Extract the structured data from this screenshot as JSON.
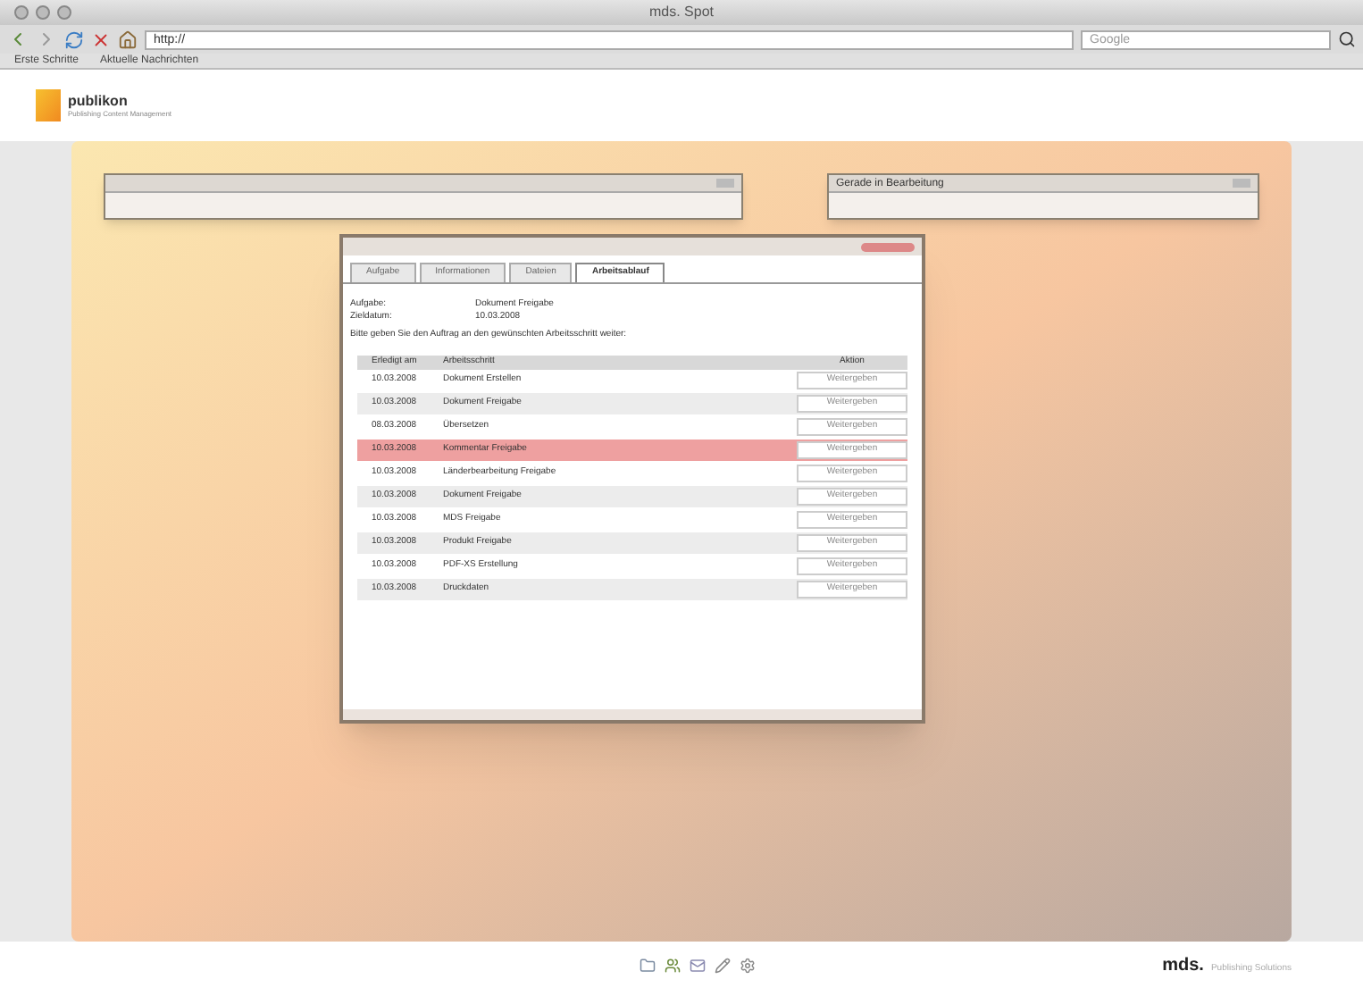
{
  "browser": {
    "title": "mds. Spot",
    "address": "http://",
    "search_placeholder": "Google",
    "bookmarks": [
      "Erste Schritte",
      "Aktuelle Nachrichten"
    ]
  },
  "header": {
    "logo": "publikon",
    "tagline": "Publishing Content Management"
  },
  "panels": [
    {
      "title": "Gerade in Bearbeitung"
    }
  ],
  "dialog": {
    "tabs": [
      {
        "label": "Aufgabe",
        "selected": false
      },
      {
        "label": "Informationen",
        "selected": false
      },
      {
        "label": "Dateien",
        "selected": false
      },
      {
        "label": "Arbeitsablauf",
        "selected": true
      }
    ],
    "fields": [
      {
        "label": "Aufgabe:",
        "value": "Dokument Freigabe"
      },
      {
        "label": "Zieldatum:",
        "value": "10.03.2008"
      }
    ],
    "instruction": "Bitte geben Sie den Auftrag an den gewünschten Arbeitsschritt weiter:",
    "columns": [
      "Erledigt am",
      "Arbeitsschritt",
      "Aktion"
    ],
    "rows": [
      {
        "date": "10.03.2008",
        "step": "Dokument Erstellen",
        "action": "Weitergeben",
        "selected": false
      },
      {
        "date": "10.03.2008",
        "step": "Dokument Freigabe",
        "action": "Weitergeben",
        "selected": false
      },
      {
        "date": "08.03.2008",
        "step": "Übersetzen",
        "action": "Weitergeben",
        "selected": false
      },
      {
        "date": "10.03.2008",
        "step": "Kommentar Freigabe",
        "action": "Weitergeben",
        "selected": true
      },
      {
        "date": "10.03.2008",
        "step": "Länderbearbeitung Freigabe",
        "action": "Weitergeben",
        "selected": false
      },
      {
        "date": "10.03.2008",
        "step": "Dokument Freigabe",
        "action": "Weitergeben",
        "selected": false
      },
      {
        "date": "10.03.2008",
        "step": "MDS Freigabe",
        "action": "Weitergeben",
        "selected": false
      },
      {
        "date": "10.03.2008",
        "step": "Produkt Freigabe",
        "action": "Weitergeben",
        "selected": false
      },
      {
        "date": "10.03.2008",
        "step": "PDF-XS Erstellung",
        "action": "Weitergeben",
        "selected": false
      },
      {
        "date": "10.03.2008",
        "step": "Druckdaten",
        "action": "Weitergeben",
        "selected": false
      }
    ]
  },
  "footer": {
    "brand": "mds.",
    "tagline": "Publishing Solutions"
  }
}
